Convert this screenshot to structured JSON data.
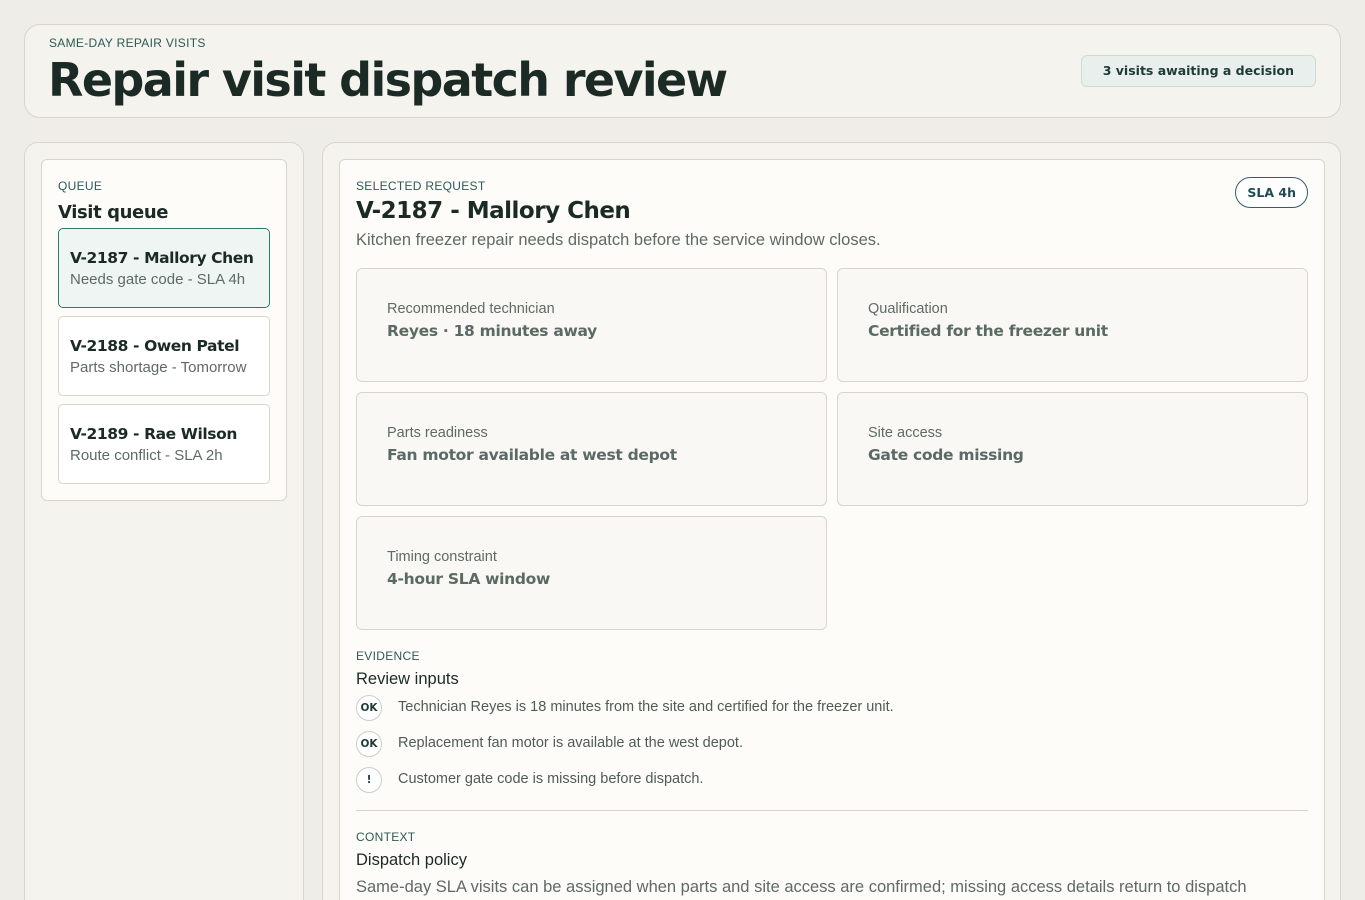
{
  "header": {
    "eyebrow": "SAME-DAY REPAIR VISITS",
    "title": "Repair visit dispatch review",
    "awaiting_badge": "3 visits awaiting a decision"
  },
  "queue": {
    "eyebrow": "QUEUE",
    "title": "Visit queue",
    "items": [
      {
        "title": "V-2187 - Mallory Chen",
        "subtitle": "Needs gate code - SLA 4h",
        "active": true
      },
      {
        "title": "V-2188 - Owen Patel",
        "subtitle": "Parts shortage - Tomorrow",
        "active": false
      },
      {
        "title": "V-2189 - Rae Wilson",
        "subtitle": "Route conflict - SLA 2h",
        "active": false
      }
    ]
  },
  "selected": {
    "eyebrow": "SELECTED REQUEST",
    "title": "V-2187 - Mallory Chen",
    "summary": "Kitchen freezer repair needs dispatch before the service window closes.",
    "sla_badge": "SLA 4h",
    "facts": [
      {
        "label": "Recommended technician",
        "value": "Reyes · 18 minutes away"
      },
      {
        "label": "Qualification",
        "value": "Certified for the freezer unit"
      },
      {
        "label": "Parts readiness",
        "value": "Fan motor available at west depot"
      },
      {
        "label": "Site access",
        "value": "Gate code missing"
      },
      {
        "label": "Timing constraint",
        "value": "4-hour SLA window"
      }
    ]
  },
  "evidence": {
    "eyebrow": "EVIDENCE",
    "title": "Review inputs",
    "items": [
      {
        "badge": "OK",
        "text": "Technician Reyes is 18 minutes from the site and certified for the freezer unit."
      },
      {
        "badge": "OK",
        "text": "Replacement fan motor is available at the west depot."
      },
      {
        "badge": "!",
        "text": "Customer gate code is missing before dispatch."
      }
    ]
  },
  "context": {
    "eyebrow": "CONTEXT",
    "title": "Dispatch policy",
    "text": "Same-day SLA visits can be assigned when parts and site access are confirmed; missing access details return to dispatch"
  },
  "colors": {
    "page_bg": "#efede7",
    "accent": "#2f7a70",
    "ink": "#1c2a26"
  }
}
